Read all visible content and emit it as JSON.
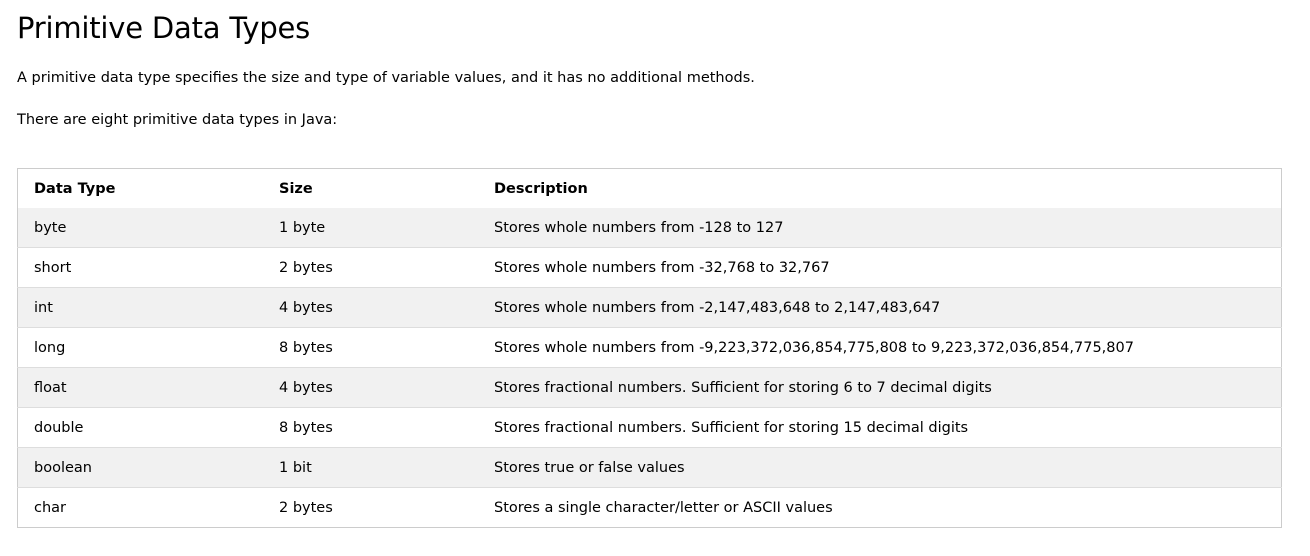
{
  "title": "Primitive Data Types",
  "intro": "A primitive data type specifies the size and type of variable values, and it has no additional methods.",
  "lead": "There are eight primitive data types in Java:",
  "table": {
    "headers": [
      "Data Type",
      "Size",
      "Description"
    ],
    "rows": [
      [
        "byte",
        "1 byte",
        "Stores whole numbers from -128 to 127"
      ],
      [
        "short",
        "2 bytes",
        "Stores whole numbers from -32,768 to 32,767"
      ],
      [
        "int",
        "4 bytes",
        "Stores whole numbers from -2,147,483,648 to 2,147,483,647"
      ],
      [
        "long",
        "8 bytes",
        "Stores whole numbers from -9,223,372,036,854,775,808 to 9,223,372,036,854,775,807"
      ],
      [
        "float",
        "4 bytes",
        "Stores fractional numbers. Sufficient for storing 6 to 7 decimal digits"
      ],
      [
        "double",
        "8 bytes",
        "Stores fractional numbers. Sufficient for storing 15 decimal digits"
      ],
      [
        "boolean",
        "1 bit",
        "Stores true or false values"
      ],
      [
        "char",
        "2 bytes",
        "Stores a single character/letter or ASCII values"
      ]
    ]
  }
}
